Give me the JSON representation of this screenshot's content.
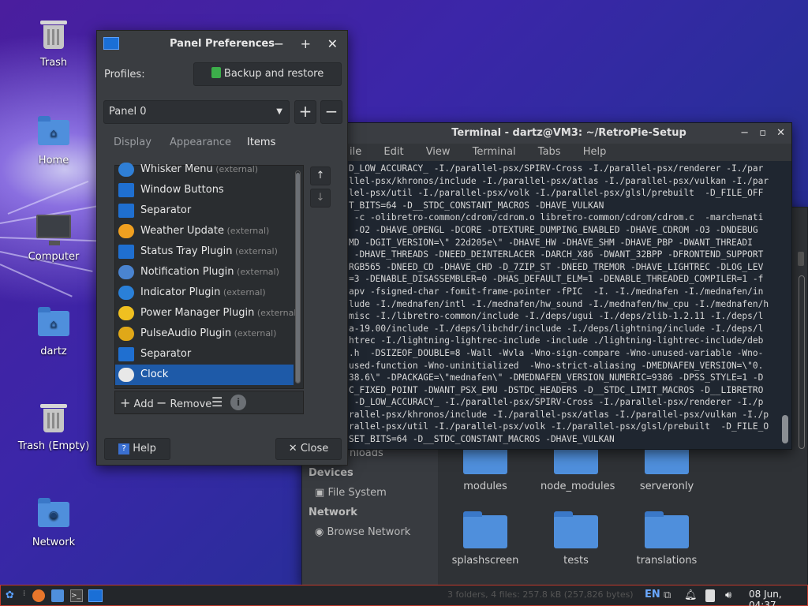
{
  "desktop": {
    "icons": [
      {
        "label": "Trash",
        "icon": "trash-icon"
      },
      {
        "label": "Home",
        "icon": "home-folder-icon"
      },
      {
        "label": "Computer",
        "icon": "computer-icon"
      },
      {
        "label": "dartz",
        "icon": "home-folder-icon"
      },
      {
        "label": "Trash (Empty)",
        "icon": "trash-icon"
      },
      {
        "label": "Network",
        "icon": "network-folder-icon"
      }
    ]
  },
  "panel_prefs": {
    "title": "Panel Preferences",
    "minimize": "−",
    "maximize": "+",
    "close": "✕",
    "profiles_label": "Profiles:",
    "backup_label": "Backup and restore",
    "panel_select": "Panel 0",
    "add_panel": "+",
    "remove_panel": "−",
    "tabs": [
      "Display",
      "Appearance",
      "Items"
    ],
    "active_tab": "Items",
    "items": [
      {
        "name": "Whisker Menu",
        "ext": "(external)",
        "icon": "whisker-menu-icon",
        "color": "#2f7fd6"
      },
      {
        "name": "Window Buttons",
        "ext": "",
        "icon": "window-buttons-icon",
        "color": "#1f6fd0"
      },
      {
        "name": "Separator",
        "ext": "",
        "icon": "separator-icon",
        "color": "#1f6fd0"
      },
      {
        "name": "Weather Update",
        "ext": "(external)",
        "icon": "weather-icon",
        "color": "#f0a020"
      },
      {
        "name": "Status Tray Plugin",
        "ext": "(external)",
        "icon": "status-tray-icon",
        "color": "#1f6fd0"
      },
      {
        "name": "Notification Plugin",
        "ext": "(external)",
        "icon": "notification-icon",
        "color": "#4a84d0"
      },
      {
        "name": "Indicator Plugin",
        "ext": "(external)",
        "icon": "indicator-icon",
        "color": "#2a80d8"
      },
      {
        "name": "Power Manager Plugin",
        "ext": "(external)",
        "icon": "power-manager-icon",
        "color": "#f0c020"
      },
      {
        "name": "PulseAudio Plugin",
        "ext": "(external)",
        "icon": "pulseaudio-icon",
        "color": "#e0a818"
      },
      {
        "name": "Separator",
        "ext": "",
        "icon": "separator-icon",
        "color": "#1f6fd0"
      },
      {
        "name": "Clock",
        "ext": "",
        "icon": "clock-icon",
        "color": "#e8e8e8"
      }
    ],
    "selected_item": "Clock",
    "move_up": "↑",
    "move_down": "↓",
    "add_label": "Add",
    "remove_label": "Remove",
    "help_label": "Help",
    "close_label": "Close"
  },
  "terminal": {
    "title": "Terminal - dartz@VM3: ~/RetroPie-Setup",
    "menu": [
      "ile",
      "Edit",
      "View",
      "Terminal",
      "Tabs",
      "Help"
    ],
    "lines": [
      "D_LOW_ACCURACY_ -I./parallel-psx/SPIRV-Cross -I./parallel-psx/renderer -I./par",
      "llel-psx/khronos/include -I./parallel-psx/atlas -I./parallel-psx/vulkan -I./par",
      "lel-psx/util -I./parallel-psx/volk -I./parallel-psx/glsl/prebuilt  -D_FILE_OFF",
      "T_BITS=64 -D__STDC_CONSTANT_MACROS -DHAVE_VULKAN",
      " -c -olibretro-common/cdrom/cdrom.o libretro-common/cdrom/cdrom.c  -march=nati",
      " -O2 -DHAVE_OPENGL -DCORE -DTEXTURE_DUMPING_ENABLED -DHAVE_CDROM -O3 -DNDEBUG",
      "MD -DGIT_VERSION=\\\" 22d205e\\\" -DHAVE_HW -DHAVE_SHM -DHAVE_PBP -DWANT_THREADI",
      " -DHAVE_THREADS -DNEED_DEINTERLACER -DARCH_X86 -DWANT_32BPP -DFRONTEND_SUPPORT",
      "RGB565 -DNEED_CD -DHAVE_CHD -D_7ZIP_ST -DNEED_TREMOR -DHAVE_LIGHTREC -DLOG_LEV",
      "=3 -DENABLE_DISASSEMBLER=0 -DHAS_DEFAULT_ELM=1 -DENABLE_THREADED_COMPILER=1 -f",
      "apv -fsigned-char -fomit-frame-pointer -fPIC  -I. -I./mednafen -I./mednafen/in",
      "lude -I./mednafen/intl -I./mednafen/hw_sound -I./mednafen/hw_cpu -I./mednafen/h",
      "misc -I./libretro-common/include -I./deps/ugui -I./deps/zlib-1.2.11 -I./deps/l",
      "a-19.00/include -I./deps/libchdr/include -I./deps/lightning/include -I./deps/l",
      "htrec -I./lightning-lightrec-include -include ./lightning-lightrec-include/deb",
      ".h  -DSIZEOF_DOUBLE=8 -Wall -Wvla -Wno-sign-compare -Wno-unused-variable -Wno-",
      "used-function -Wno-uninitialized  -Wno-strict-aliasing -DMEDNAFEN_VERSION=\\\"0.",
      "38.6\\\" -DPACKAGE=\\\"mednafen\\\" -DMEDNAFEN_VERSION_NUMERIC=9386 -DPSS_STYLE=1 -D",
      "C_FIXED_POINT -DWANT_PSX_EMU -DSTDC_HEADERS -D__STDC_LIMIT_MACROS -D__LIBRETRO",
      " -D_LOW_ACCURACY_ -I./parallel-psx/SPIRV-Cross -I./parallel-psx/renderer -I./p",
      "rallel-psx/khronos/include -I./parallel-psx/atlas -I./parallel-psx/vulkan -I./p",
      "rallel-psx/util -I./parallel-psx/volk -I./parallel-psx/glsl/prebuilt  -D_FILE_O",
      "SET_BITS=64 -D__STDC_CONSTANT_MACROS -DHAVE_VULKAN"
    ]
  },
  "file_manager": {
    "downloads_partial": "nloads",
    "devices_header": "Devices",
    "file_system": "File System",
    "network_header": "Network",
    "browse_network": "Browse Network",
    "folders": [
      "modules",
      "node_modules",
      "serveronly",
      "splashscreen",
      "tests",
      "translations"
    ],
    "status": "3 folders, 4 files: 257.8 kB (257,826 bytes)"
  },
  "taskbar": {
    "language": "EN",
    "datetime": "08 Jun, 04:37"
  }
}
